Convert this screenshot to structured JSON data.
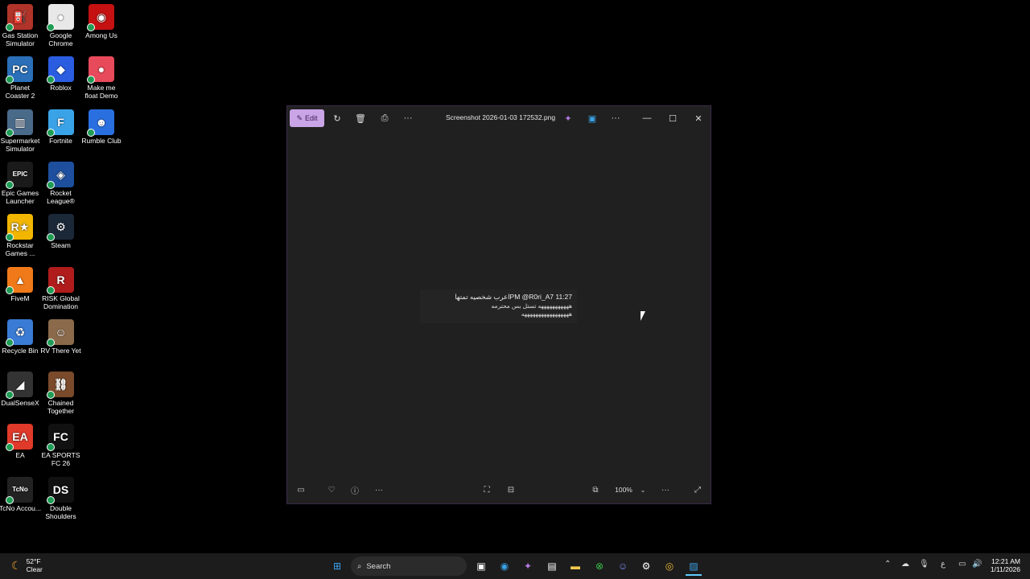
{
  "desktop": {
    "icons": [
      {
        "label": "Gas Station Simulator",
        "glyph": "⛽",
        "color": "#b0342a"
      },
      {
        "label": "Google Chrome",
        "glyph": "●",
        "color": "#e8e8e8"
      },
      {
        "label": "Among Us",
        "glyph": "◉",
        "color": "#c51111"
      },
      {
        "label": "Planet Coaster 2",
        "glyph": "PC",
        "color": "#2a6fb8"
      },
      {
        "label": "Roblox",
        "glyph": "◆",
        "color": "#2a5de0"
      },
      {
        "label": "Make me float Demo",
        "glyph": "●",
        "color": "#e74a5a"
      },
      {
        "label": "Supermarket Simulator",
        "glyph": "▥",
        "color": "#4a6a8a"
      },
      {
        "label": "Fortnite",
        "glyph": "F",
        "color": "#3aa3e8"
      },
      {
        "label": "Rumble Club",
        "glyph": "☻",
        "color": "#2a6fe0"
      },
      {
        "label": "Epic Games Launcher",
        "glyph": "EPIC",
        "color": "#1a1a1a"
      },
      {
        "label": "Rocket League®",
        "glyph": "◈",
        "color": "#1d4f9e"
      },
      {
        "label": "Rockstar Games ...",
        "glyph": "R★",
        "color": "#f2b600"
      },
      {
        "label": "Steam",
        "glyph": "⚙",
        "color": "#1b2838"
      },
      {
        "label": "FiveM",
        "glyph": "▲",
        "color": "#f07a1a"
      },
      {
        "label": "RISK Global Domination",
        "glyph": "R",
        "color": "#b01c1c"
      },
      {
        "label": "Recycle Bin",
        "glyph": "♻",
        "color": "#3a7bd5"
      },
      {
        "label": "RV There Yet",
        "glyph": "☺",
        "color": "#8a6a4a"
      },
      {
        "label": "DualSenseX",
        "glyph": "◢",
        "color": "#333"
      },
      {
        "label": "Chained Together",
        "glyph": "⛓",
        "color": "#7a4a2a"
      },
      {
        "label": "EA",
        "glyph": "EA",
        "color": "#e03a2a"
      },
      {
        "label": "EA SPORTS FC 26",
        "glyph": "FC",
        "color": "#111"
      },
      {
        "label": "TcNo Accou...",
        "glyph": "TcNo",
        "color": "#222"
      },
      {
        "label": "Double Shoulders",
        "glyph": "DS",
        "color": "#111"
      }
    ]
  },
  "window": {
    "edit_label": "Edit",
    "title": "Screenshot 2026-01-03 172532.png",
    "image_text": {
      "line1": "11:27 PM @R0ri_A7اعرب شخصيه تمتها",
      "line2": "هههههههههههه تستل بس محترمه",
      "line3": "هههههههههههههههههه"
    },
    "zoom": "100%"
  },
  "taskbar": {
    "weather_temp": "52°F",
    "weather_desc": "Clear",
    "search_label": "Search",
    "time": "12:21 AM",
    "date": "1/11/2026",
    "lang": "ع"
  }
}
